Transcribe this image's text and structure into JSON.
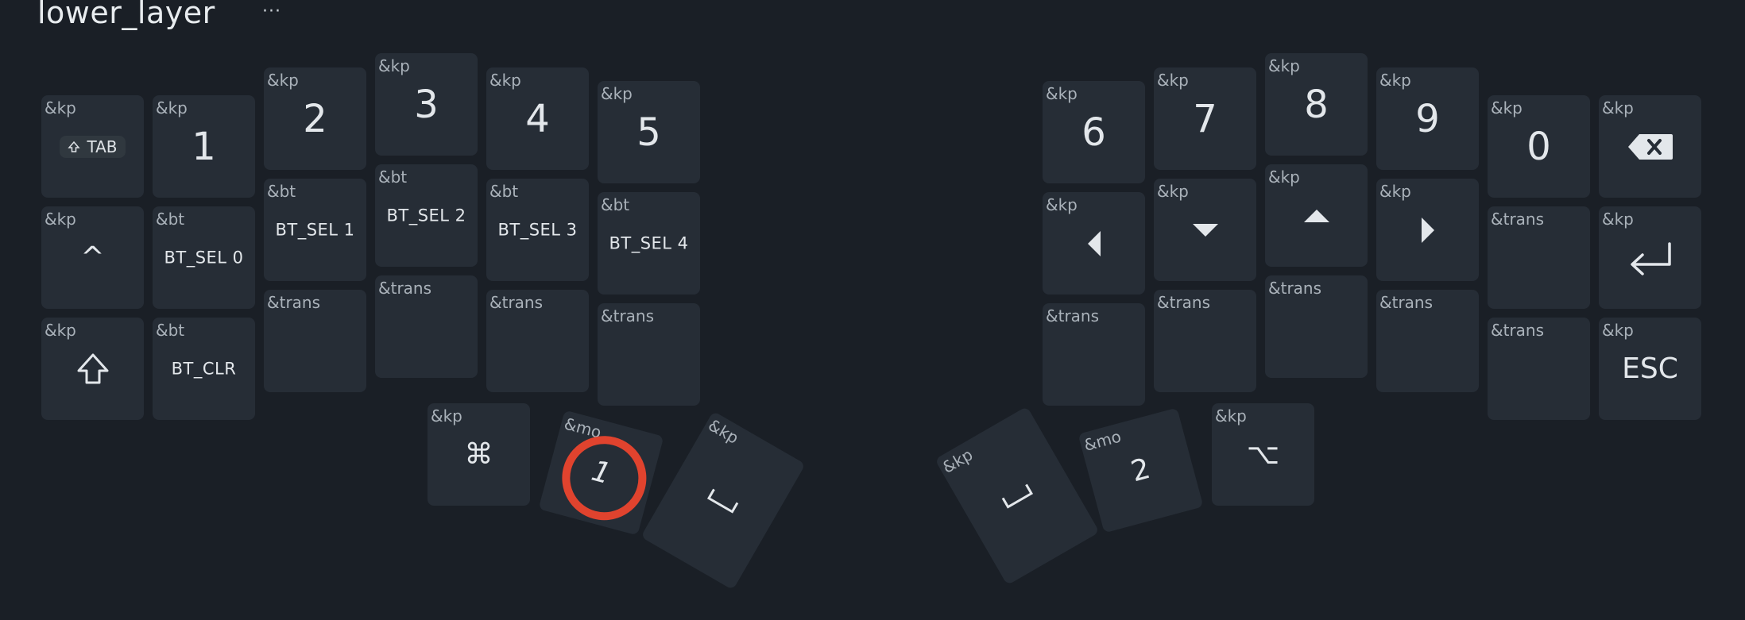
{
  "header": {
    "title": "lower_layer",
    "menu": "···"
  },
  "keys": {
    "l_tab": {
      "behavior": "&kp",
      "label": "TAB"
    },
    "l_1": {
      "behavior": "&kp",
      "label": "1"
    },
    "l_2": {
      "behavior": "&kp",
      "label": "2"
    },
    "l_3": {
      "behavior": "&kp",
      "label": "3"
    },
    "l_4": {
      "behavior": "&kp",
      "label": "4"
    },
    "l_5": {
      "behavior": "&kp",
      "label": "5"
    },
    "l_caret": {
      "behavior": "&kp",
      "label": "^"
    },
    "l_bt0": {
      "behavior": "&bt",
      "label": "BT_SEL 0"
    },
    "l_bt1": {
      "behavior": "&bt",
      "label": "BT_SEL 1"
    },
    "l_bt2": {
      "behavior": "&bt",
      "label": "BT_SEL 2"
    },
    "l_bt3": {
      "behavior": "&bt",
      "label": "BT_SEL 3"
    },
    "l_bt4": {
      "behavior": "&bt",
      "label": "BT_SEL 4"
    },
    "l_shift": {
      "behavior": "&kp",
      "icon": "shift-icon"
    },
    "l_btclr": {
      "behavior": "&bt",
      "label": "BT_CLR"
    },
    "l_tr2": {
      "behavior": "&trans"
    },
    "l_tr3": {
      "behavior": "&trans"
    },
    "l_tr4": {
      "behavior": "&trans"
    },
    "l_tr5": {
      "behavior": "&trans"
    },
    "l_cmd": {
      "behavior": "&kp",
      "icon": "command-icon"
    },
    "l_mo1": {
      "behavior": "&mo",
      "label": "1"
    },
    "l_space": {
      "behavior": "&kp",
      "icon": "space-icon"
    },
    "r_6": {
      "behavior": "&kp",
      "label": "6"
    },
    "r_7": {
      "behavior": "&kp",
      "label": "7"
    },
    "r_8": {
      "behavior": "&kp",
      "label": "8"
    },
    "r_9": {
      "behavior": "&kp",
      "label": "9"
    },
    "r_0": {
      "behavior": "&kp",
      "label": "0"
    },
    "r_bksp": {
      "behavior": "&kp",
      "icon": "backspace-icon"
    },
    "r_left": {
      "behavior": "&kp",
      "icon": "arrow-left-icon"
    },
    "r_down": {
      "behavior": "&kp",
      "icon": "arrow-down-icon"
    },
    "r_up": {
      "behavior": "&kp",
      "icon": "arrow-up-icon"
    },
    "r_right": {
      "behavior": "&kp",
      "icon": "arrow-right-icon"
    },
    "r_tr5": {
      "behavior": "&trans"
    },
    "r_enter": {
      "behavior": "&kp",
      "icon": "enter-icon"
    },
    "r_tr0": {
      "behavior": "&trans"
    },
    "r_tr1": {
      "behavior": "&trans"
    },
    "r_tr2": {
      "behavior": "&trans"
    },
    "r_tr3": {
      "behavior": "&trans"
    },
    "r_tr4": {
      "behavior": "&trans"
    },
    "r_esc": {
      "behavior": "&kp",
      "label": "ESC"
    },
    "r_space": {
      "behavior": "&kp",
      "icon": "space-icon"
    },
    "r_mo2": {
      "behavior": "&mo",
      "label": "2"
    },
    "r_opt": {
      "behavior": "&kp",
      "icon": "option-icon"
    }
  },
  "colors": {
    "background": "#1a1f26",
    "key": "#262d36",
    "highlight": "#e0432e"
  }
}
